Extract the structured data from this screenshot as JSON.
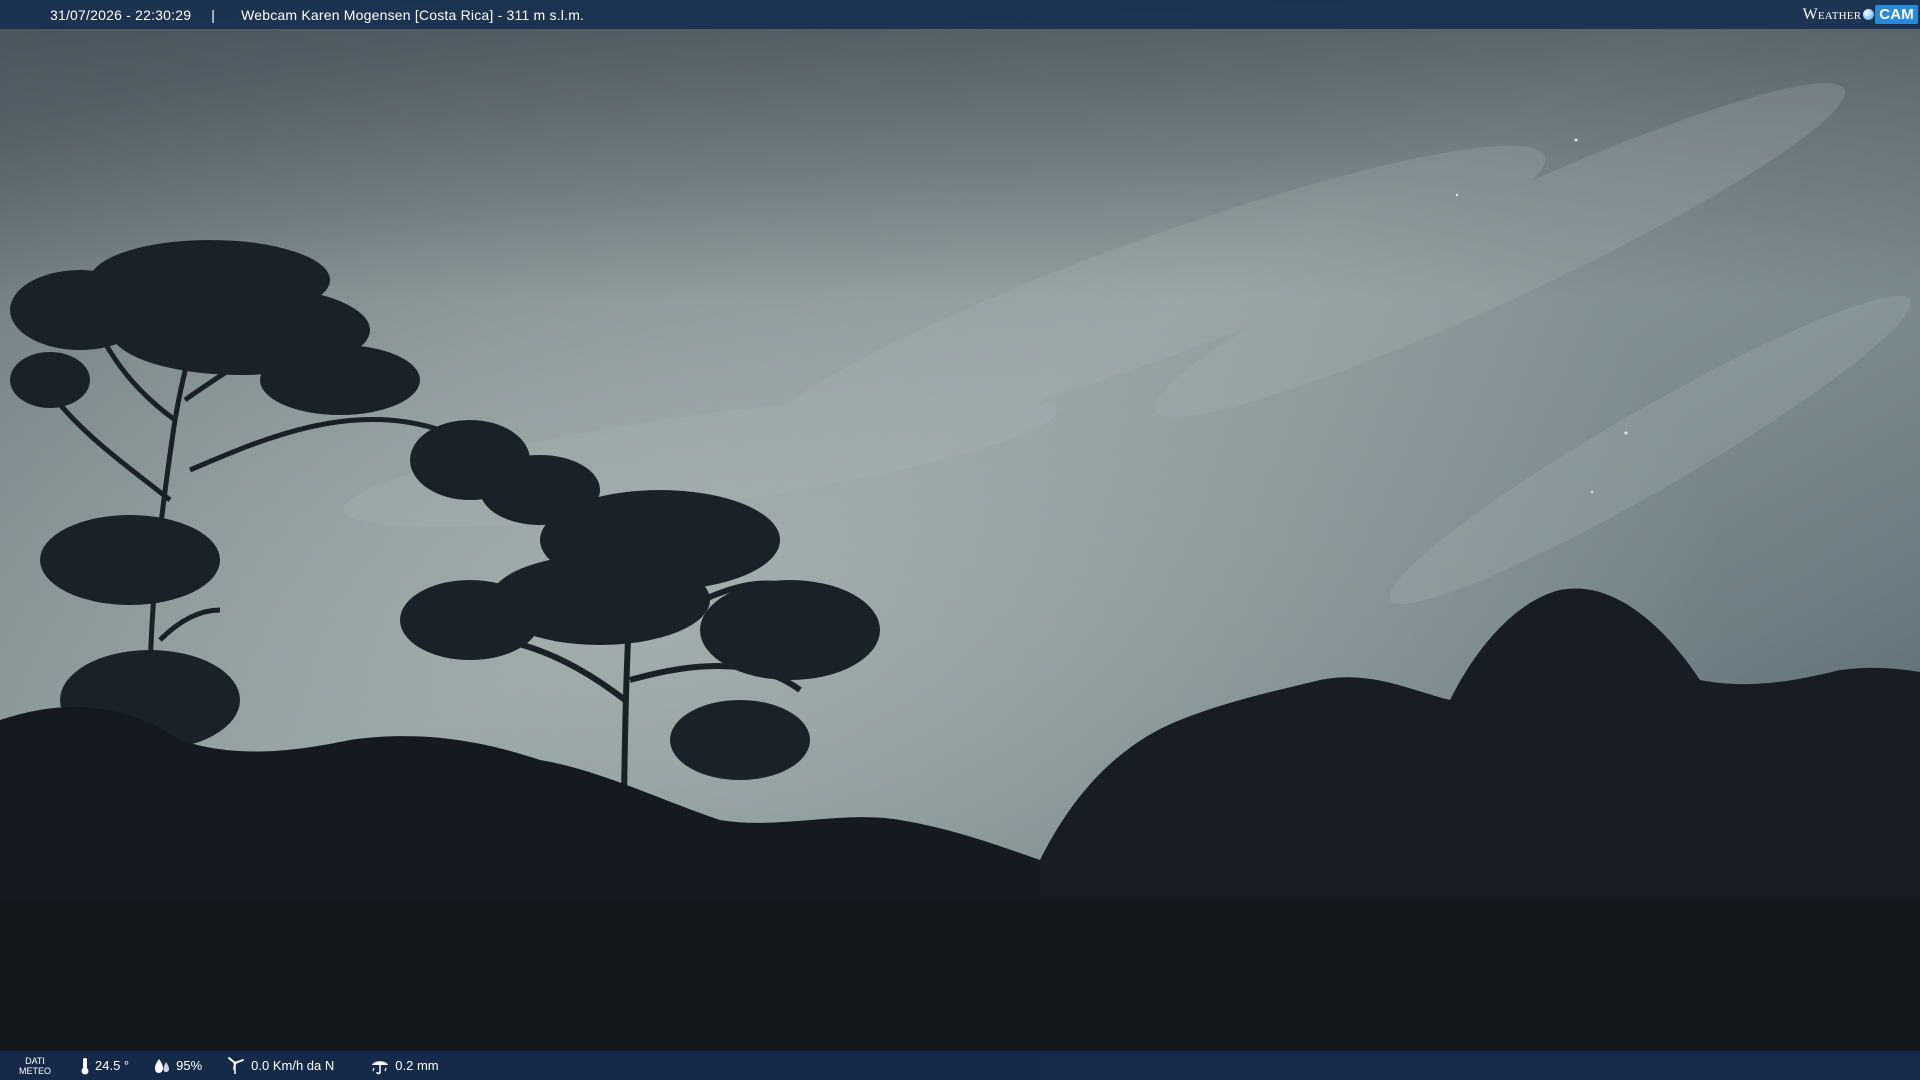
{
  "overlay": {
    "datetime": "31/07/2026 - 22:30:29",
    "separator": "|",
    "title": "Webcam Karen Mogensen [Costa Rica]  - 311 m s.l.m.",
    "logo": {
      "weather": "Weather",
      "cam": "CAM",
      "accent_color": "#2a8ad8"
    }
  },
  "weather_bar": {
    "label_line1": "DATI",
    "label_line2": "METEO",
    "temperature": "24.5 °",
    "humidity": "95%",
    "wind": "0.0 Km/h da N",
    "rain": "0.2 mm",
    "icons": [
      "thermometer-icon",
      "humidity-icon",
      "wind-icon",
      "rain-icon"
    ]
  },
  "scene": {
    "description_colors": {
      "sky": "#8e9c9e",
      "sky_dark": "#4c5a62",
      "foliage": "#15191c"
    }
  }
}
